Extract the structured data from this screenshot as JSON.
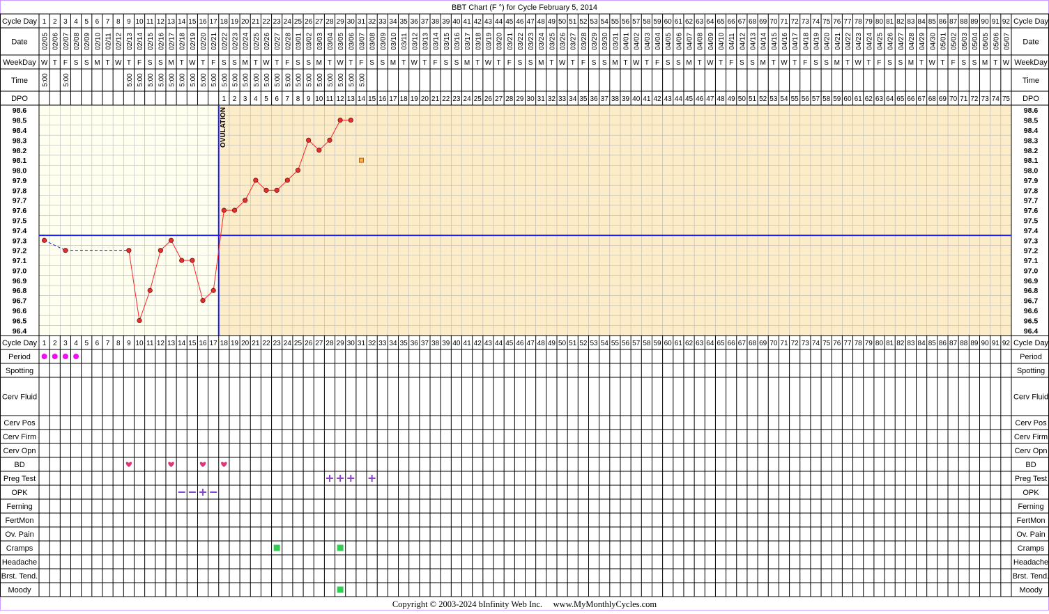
{
  "title": "BBT Chart (F °) for Cycle February 5, 2014",
  "copyright": "Copyright © 2003-2024 bInfinity Web Inc.     www.MyMonthlyCycles.com",
  "colors": {
    "border": "#cc99ff",
    "pre_ovulation_bg": "#fffff0",
    "post_ovulation_bg": "#fcecc8",
    "grid": "#b8b8b8",
    "coverline": "#1a1aff",
    "temp_line": "#ff2020",
    "temp_dot": "#e03030",
    "period_dot": "#ee11ee",
    "heart": "#dd3377",
    "plus": "#8844cc",
    "green_box": "#33cc55",
    "orange_box": "#ffaa44"
  },
  "row_labels": {
    "cycle_day": "Cycle Day",
    "date": "Date",
    "weekday": "WeekDay",
    "time": "Time",
    "dpo": "DPO"
  },
  "cycle_days": [
    "1",
    "2",
    "3",
    "4",
    "5",
    "6",
    "7",
    "8",
    "9",
    "10",
    "11",
    "12",
    "13",
    "14",
    "15",
    "16",
    "17",
    "18",
    "19",
    "20",
    "21",
    "22",
    "23",
    "24",
    "25",
    "26",
    "27",
    "28",
    "29",
    "30",
    "31",
    "32",
    "33",
    "34",
    "35",
    "36",
    "37",
    "38",
    "39",
    "40",
    "41",
    "42",
    "43",
    "44",
    "45",
    "46",
    "47",
    "48",
    "49",
    "50",
    "51",
    "52",
    "53",
    "54",
    "55",
    "56",
    "57",
    "58",
    "59",
    "60",
    "61",
    "62",
    "63",
    "64",
    "65",
    "66",
    "67",
    "68",
    "69",
    "70",
    "71",
    "72",
    "73",
    "74",
    "75",
    "76",
    "77",
    "78",
    "79",
    "80",
    "81",
    "82",
    "83",
    "84",
    "85",
    "86",
    "87",
    "88",
    "89",
    "90",
    "91",
    "92"
  ],
  "dates": [
    "02/05",
    "02/06",
    "02/07",
    "02/08",
    "02/09",
    "02/10",
    "02/11",
    "02/12",
    "02/13",
    "02/14",
    "02/15",
    "02/16",
    "02/17",
    "02/18",
    "02/19",
    "02/20",
    "02/21",
    "02/22",
    "02/23",
    "02/24",
    "02/25",
    "02/26",
    "02/27",
    "02/28",
    "03/01",
    "03/02",
    "03/03",
    "03/04",
    "03/05",
    "03/06",
    "03/07",
    "03/08",
    "03/09",
    "03/10",
    "03/11",
    "03/12",
    "03/13",
    "03/14",
    "03/15",
    "03/16",
    "03/17",
    "03/18",
    "03/19",
    "03/20",
    "03/21",
    "03/22",
    "03/23",
    "03/24",
    "03/25",
    "03/26",
    "03/27",
    "03/28",
    "03/29",
    "03/30",
    "03/31",
    "04/01",
    "04/02",
    "04/03",
    "04/04",
    "04/05",
    "04/06",
    "04/07",
    "04/08",
    "04/09",
    "04/10",
    "04/11",
    "04/12",
    "04/13",
    "04/14",
    "04/15",
    "04/16",
    "04/17",
    "04/18",
    "04/19",
    "04/20",
    "04/21",
    "04/22",
    "04/23",
    "04/24",
    "04/25",
    "04/26",
    "04/27",
    "04/28",
    "04/29",
    "04/30",
    "05/01",
    "05/02",
    "05/03",
    "05/04",
    "05/05",
    "05/06",
    "05/07"
  ],
  "weekdays": [
    "W",
    "T",
    "F",
    "S",
    "S",
    "M",
    "T",
    "W",
    "T",
    "F",
    "S",
    "S",
    "M",
    "T",
    "W",
    "T",
    "F",
    "S",
    "S",
    "M",
    "T",
    "W",
    "T",
    "F",
    "S",
    "S",
    "M",
    "T",
    "W",
    "T",
    "F",
    "S",
    "S",
    "M",
    "T",
    "W",
    "T",
    "F",
    "S",
    "S",
    "M",
    "T",
    "W",
    "T",
    "F",
    "S",
    "S",
    "M",
    "T",
    "W",
    "T",
    "F",
    "S",
    "S",
    "M",
    "T",
    "W",
    "T",
    "F",
    "S",
    "S",
    "M",
    "T",
    "W",
    "T",
    "F",
    "S",
    "S",
    "M",
    "T",
    "W",
    "T",
    "F",
    "S",
    "S",
    "M",
    "T",
    "W",
    "T",
    "F",
    "S",
    "S",
    "M",
    "T",
    "W",
    "T",
    "F",
    "S",
    "S",
    "M",
    "T",
    "W"
  ],
  "times": [
    "5:00",
    "",
    "5:00",
    "",
    "",
    "",
    "",
    "",
    "5:00",
    "5:00",
    "5:00",
    "5:00",
    "5:00",
    "5:00",
    "5:00",
    "5:00",
    "5:00",
    "5:00",
    "5:00",
    "5:00",
    "5:00",
    "5:00",
    "5:00",
    "5:00",
    "5:00",
    "5:00",
    "5:00",
    "5:00",
    "5:00",
    "5:00",
    "5:00"
  ],
  "dpo": [
    "",
    "",
    "",
    "",
    "",
    "",
    "",
    "",
    "",
    "",
    "",
    "",
    "",
    "",
    "",
    "",
    "",
    "1",
    "2",
    "3",
    "4",
    "5",
    "6",
    "7",
    "8",
    "9",
    "10",
    "11",
    "12",
    "13",
    "14",
    "15",
    "16",
    "17",
    "18",
    "19",
    "20",
    "21",
    "22",
    "23",
    "24",
    "25",
    "26",
    "27",
    "28",
    "29",
    "30",
    "31",
    "32",
    "33",
    "34",
    "35",
    "36",
    "37",
    "38",
    "39",
    "40",
    "41",
    "42",
    "43",
    "44",
    "45",
    "46",
    "47",
    "48",
    "49",
    "50",
    "51",
    "52",
    "53",
    "54",
    "55",
    "56",
    "57",
    "58",
    "59",
    "60",
    "61",
    "62",
    "63",
    "64",
    "65",
    "66",
    "67",
    "68",
    "69",
    "70",
    "71",
    "72",
    "73",
    "74",
    "75"
  ],
  "temp_axis": [
    "98.6",
    "98.5",
    "98.4",
    "98.3",
    "98.2",
    "98.1",
    "98.0",
    "97.9",
    "97.8",
    "97.7",
    "97.6",
    "97.5",
    "97.4",
    "97.3",
    "97.2",
    "97.1",
    "97.0",
    "96.9",
    "96.8",
    "96.7",
    "96.6",
    "96.5",
    "96.4"
  ],
  "ovulation_label": "OVULATION",
  "symptom_rows": [
    "Period",
    "Spotting",
    "Cerv Fluid",
    "Cerv Pos",
    "Cerv Firm",
    "Cerv Opn",
    "BD",
    "Preg Test",
    "OPK",
    "Ferning",
    "FertMon",
    "Ov. Pain",
    "Cramps",
    "Headache",
    "Brst. Tend.",
    "Moody"
  ],
  "chart_data": {
    "type": "line",
    "title": "BBT Chart (F °) for Cycle February 5, 2014",
    "x_label": "Cycle Day",
    "ylim": [
      96.4,
      98.6
    ],
    "coverline": 97.4,
    "ovulation_day": 17,
    "temperatures": [
      {
        "day": 1,
        "temp": 97.3
      },
      {
        "day": 3,
        "temp": 97.2
      },
      {
        "day": 9,
        "temp": 97.2
      },
      {
        "day": 10,
        "temp": 96.5
      },
      {
        "day": 11,
        "temp": 96.8
      },
      {
        "day": 12,
        "temp": 97.2
      },
      {
        "day": 13,
        "temp": 97.3
      },
      {
        "day": 14,
        "temp": 97.1
      },
      {
        "day": 15,
        "temp": 97.1
      },
      {
        "day": 16,
        "temp": 96.7
      },
      {
        "day": 17,
        "temp": 96.8
      },
      {
        "day": 18,
        "temp": 97.6
      },
      {
        "day": 19,
        "temp": 97.6
      },
      {
        "day": 20,
        "temp": 97.7
      },
      {
        "day": 21,
        "temp": 97.9
      },
      {
        "day": 22,
        "temp": 97.8
      },
      {
        "day": 23,
        "temp": 97.8
      },
      {
        "day": 24,
        "temp": 97.9
      },
      {
        "day": 25,
        "temp": 98.0
      },
      {
        "day": 26,
        "temp": 98.3
      },
      {
        "day": 27,
        "temp": 98.2
      },
      {
        "day": 28,
        "temp": 98.3
      },
      {
        "day": 29,
        "temp": 98.5
      },
      {
        "day": 30,
        "temp": 98.5
      }
    ],
    "dashed_segments": [
      [
        1,
        3
      ],
      [
        3,
        9
      ]
    ],
    "extra_markers": [
      {
        "day": 31,
        "temp": 98.1,
        "kind": "square"
      }
    ],
    "symptoms": {
      "period": [
        1,
        2,
        3,
        4
      ],
      "bd": [
        9,
        13,
        16,
        18
      ],
      "preg_test_plus": [
        28,
        29,
        30,
        32
      ],
      "opk": [
        {
          "day": 14,
          "mark": "–"
        },
        {
          "day": 15,
          "mark": "–"
        },
        {
          "day": 16,
          "mark": "+"
        },
        {
          "day": 17,
          "mark": "–"
        }
      ],
      "cramps": [
        23,
        29
      ],
      "moody": [
        29
      ]
    }
  }
}
